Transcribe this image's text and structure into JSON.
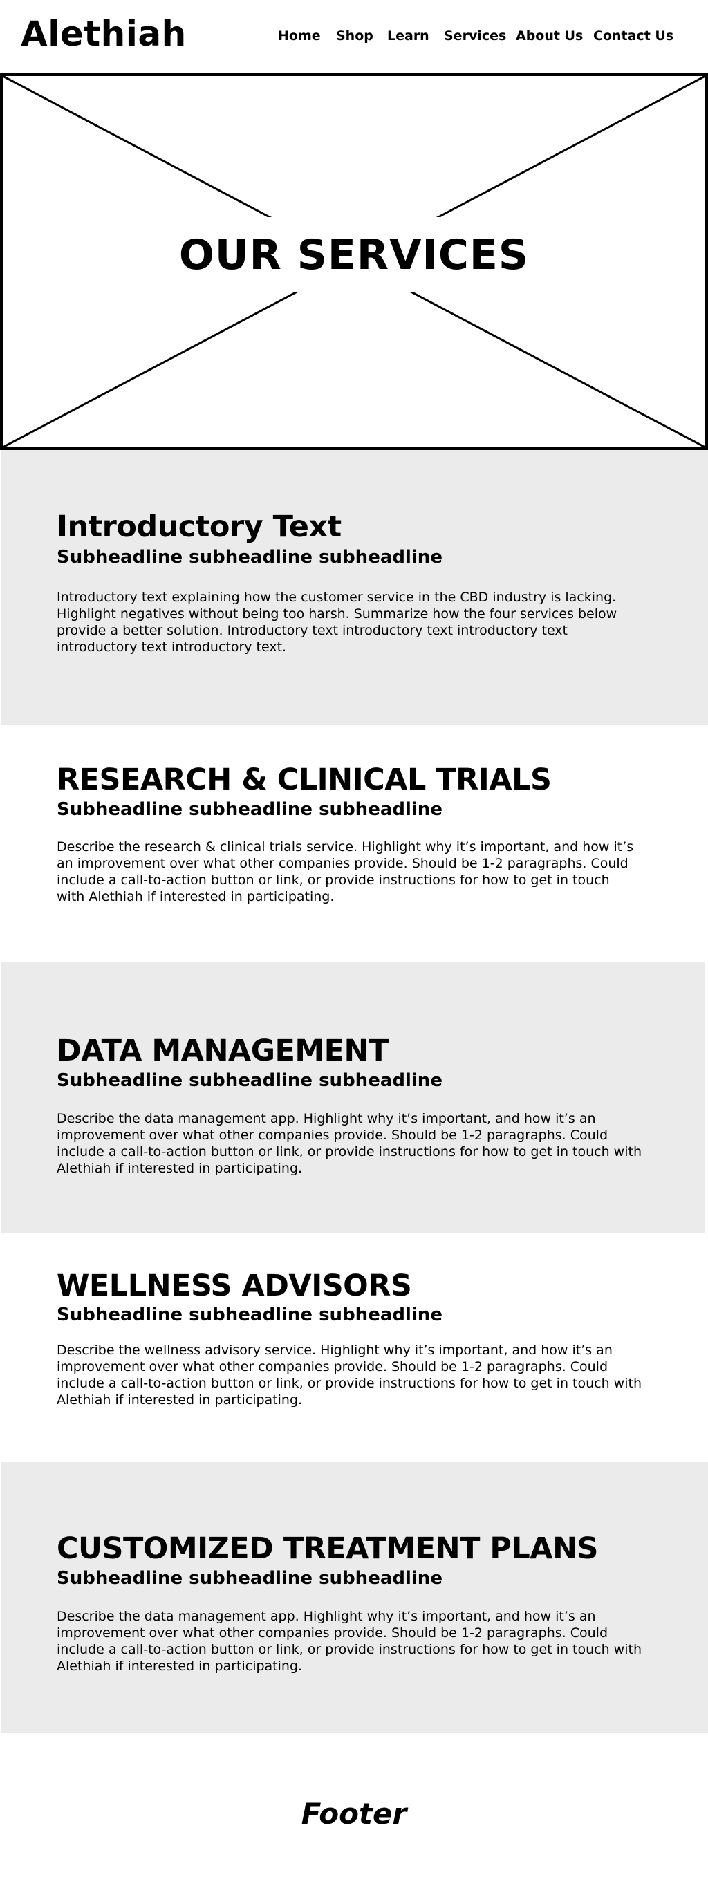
{
  "header": {
    "logo": "Alethiah",
    "nav": [
      "Home",
      "Shop",
      "Learn",
      "Services",
      "About Us",
      "Contact Us"
    ]
  },
  "hero": {
    "title": "OUR SERVICES",
    "image_placeholder": "image-placeholder"
  },
  "sections": [
    {
      "title": "Introductory Text",
      "subtitle": "Subheadline subheadline subheadline",
      "body": "Introductory text explaining how the customer service in the CBD industry is lacking. Highlight negatives without being too harsh. Summarize how the four services below provide a better solution. Introductory text introductory text introductory text introductory text introductory text."
    },
    {
      "title": "RESEARCH & CLINICAL TRIALS",
      "subtitle": "Subheadline subheadline subheadline",
      "body": "Describe the research & clinical trials service. Highlight why it’s important, and how it’s an improvement over what other companies provide. Should be 1-2 paragraphs. Could include a call-to-action button or link, or provide instructions for how to get in touch with Alethiah if interested in participating."
    },
    {
      "title": "DATA MANAGEMENT",
      "subtitle": "Subheadline subheadline subheadline",
      "body": "Describe the data management app. Highlight why it’s important, and how it’s an improvement over what other companies provide. Should be 1-2 paragraphs. Could include a call-to-action button or link, or provide instructions for how to get in touch with Alethiah if interested in participating."
    },
    {
      "title": "WELLNESS ADVISORS",
      "subtitle": "Subheadline subheadline subheadline",
      "body": "Describe the wellness advisory service. Highlight why it’s important, and how it’s an improvement over what other companies provide. Should be 1-2 paragraphs. Could include a call-to-action button or link, or provide instructions for how to get in touch with Alethiah if interested in participating."
    },
    {
      "title": "CUSTOMIZED TREATMENT PLANS",
      "subtitle": "Subheadline subheadline subheadline",
      "body": "Describe the data management app. Highlight why it’s important, and how it’s an improvement over what other companies provide. Should be 1-2 paragraphs. Could include a call-to-action button or link, or provide instructions for how to get in touch with Alethiah if interested in participating."
    }
  ],
  "footer": {
    "label": "Footer"
  },
  "colors": {
    "section_gray": "#ebebeb",
    "text": "#000000",
    "background": "#ffffff"
  }
}
